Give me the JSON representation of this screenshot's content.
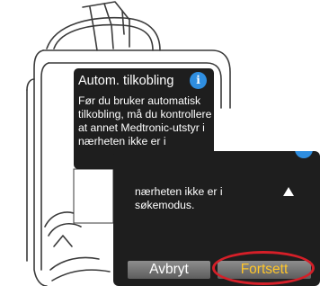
{
  "screen1": {
    "title": "Autom. tilkobling",
    "info_icon": "info-icon",
    "body": "Før du bruker automatisk tilkobling, må du kontrollere at annet Medtronic-utstyr i nærheten ikke er i",
    "scroll_icon": "down-arrow-icon"
  },
  "screen2": {
    "body": "nærheten ikke er i søkemodus.",
    "scroll_icon": "up-arrow-icon",
    "cancel_label": "Avbryt",
    "continue_label": "Fortsett"
  },
  "colors": {
    "screen_bg": "#1e1e1e",
    "info_blue": "#2f8ee0",
    "continue_yellow": "#ffc629",
    "callout_red": "#d51f28"
  }
}
